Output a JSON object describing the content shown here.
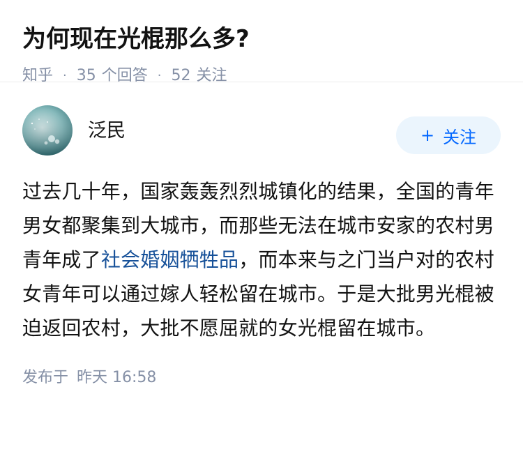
{
  "question": {
    "title": "为何现在光棍那么多?",
    "source": "知乎",
    "answer_count": "35",
    "answer_label": "个回答",
    "follower_count": "52",
    "follower_label": "关注"
  },
  "answer": {
    "author": "泛民",
    "follow_button": "关注",
    "paragraph_before": "过去几十年，国家轰轰烈烈城镇化的结果，全国的青年男女都聚集到大城市，而那些无法在城市安家的农村男青年成了",
    "link_text": "社会婚姻牺牲品",
    "paragraph_after": "，而本来与之门当户对的农村女青年可以通过嫁人轻松留在城市。于是大批男光棍被迫返回农村，大批不愿屈就的女光棍留在城市。",
    "published_label": "发布于",
    "published_time": "昨天 16:58"
  },
  "colors": {
    "accent": "#0066ff",
    "follow_bg": "#ebf5fd",
    "link": "#175199",
    "meta": "#8590a6",
    "text": "#121212"
  },
  "icons": {
    "dot": "middle-dot",
    "plus": "plus-icon"
  }
}
